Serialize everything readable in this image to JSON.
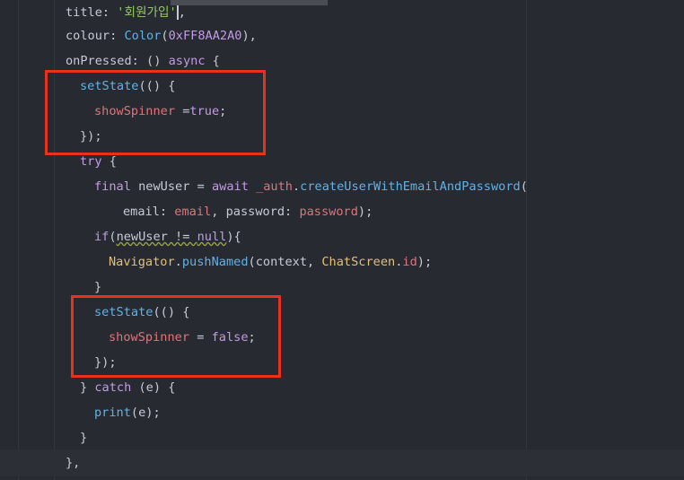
{
  "code": {
    "l1_key": "title: ",
    "l1_str": "'회원가입'",
    "l1_end": ",",
    "l2_key": "colour: ",
    "l2_cls": "Color",
    "l2_open": "(",
    "l2_num": "0xFF8AA2A0",
    "l2_end": "),",
    "l3_key": "onPressed: () ",
    "l3_kw": "async",
    "l3_end": " {",
    "l4_fn": "setState",
    "l4_end": "(() {",
    "l5_prop": "showSpinner",
    "l5_op": " =",
    "l5_kw": "true",
    "l5_end": ";",
    "l6": "});",
    "l7_kw": "try",
    "l7_end": " {",
    "l8_kw1": "final",
    "l8_var": " newUser = ",
    "l8_kw2": "await",
    "l8_sp": " ",
    "l8_prop": "_auth",
    "l8_dot": ".",
    "l8_fn": "createUserWithEmailAndPassword",
    "l8_end": "(",
    "l9_key1": "email: ",
    "l9_val1": "email",
    "l9_sep": ", password: ",
    "l9_val2": "password",
    "l9_end": ");",
    "l10_kw": "if",
    "l10_open": "(",
    "l10_cond": "newUser != ",
    "l10_null": "null",
    "l10_end": "){",
    "l11_cls": "Navigator",
    "l11_dot": ".",
    "l11_fn": "pushNamed",
    "l11_mid": "(context, ",
    "l11_cls2": "ChatScreen",
    "l11_dot2": ".",
    "l11_prop": "id",
    "l11_end": ");",
    "l12": "}",
    "l13_fn": "setState",
    "l13_end": "(() {",
    "l14_prop": "showSpinner",
    "l14_op": " = ",
    "l14_kw": "false",
    "l14_end": ";",
    "l15": "});",
    "l16_pre": "} ",
    "l16_kw": "catch",
    "l16_end": " (e) {",
    "l17_fn": "print",
    "l17_end": "(e);",
    "l18": "}",
    "l19": "},"
  },
  "colors": {
    "highlight_box": "#e8321c",
    "background": "#272a31"
  }
}
